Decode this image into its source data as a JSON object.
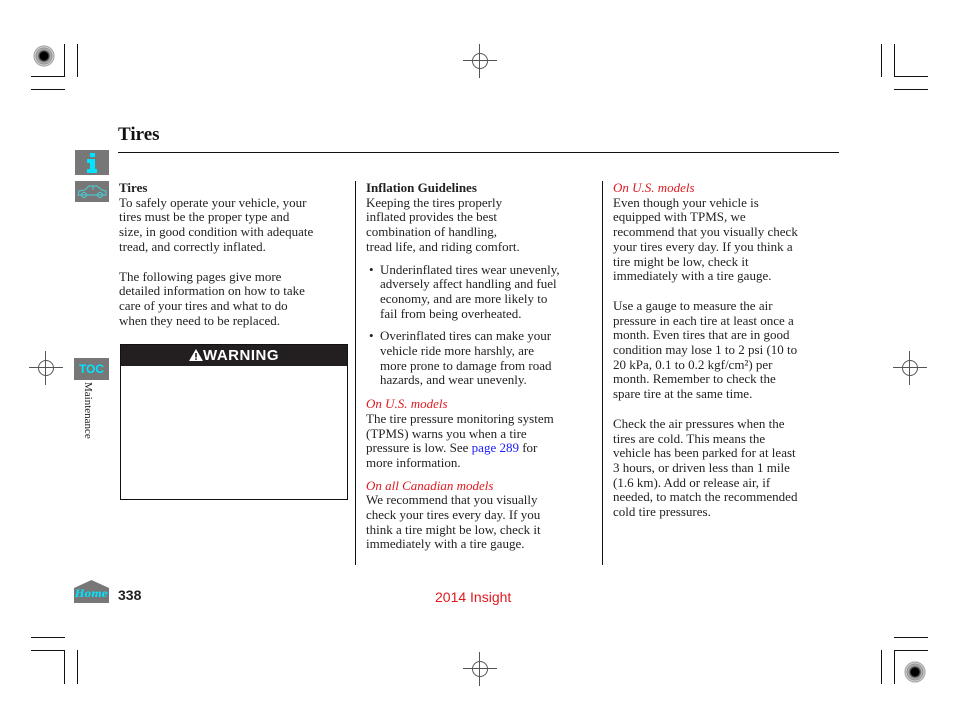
{
  "header": {
    "title": "Tires"
  },
  "side_nav": {
    "info_icon": "info-icon",
    "car_icon": "car-icon",
    "toc_label": "TOC",
    "section_label": "Maintenance",
    "home_label": "Home"
  },
  "column1": {
    "heading": "Tires",
    "paragraphs": [
      "To safely operate your vehicle, your tires must be the proper type and size, in good condition with adequate tread, and correctly inflated.",
      "The following pages give more detailed information on how to take care of your tires and what to do when they need to be replaced."
    ],
    "lines_p1": [
      "To safely operate your vehicle, your",
      "tires must be the proper type and",
      "size, in good condition with adequate",
      "tread, and correctly inflated."
    ],
    "lines_p2": [
      "The following pages give more",
      "detailed information on how to take",
      "care of your tires and what to do",
      "when they need to be replaced."
    ],
    "warning": {
      "label": "WARNING",
      "icon": "warning-triangle-icon"
    }
  },
  "column2": {
    "heading": "Inflation Guidelines",
    "intro_lines": [
      "Keeping the tires properly",
      "inflated provides the best",
      "combination of handling,",
      "tread life, and riding comfort."
    ],
    "bullets": [
      {
        "lines": [
          "Underinflated tires wear unevenly,",
          "adversely affect handling and fuel",
          "economy, and are more likely to",
          "fail from being overheated."
        ]
      },
      {
        "lines": [
          "Overinflated tires can make your",
          "vehicle ride more harshly, are",
          "more prone to damage from road",
          "hazards, and wear unevenly."
        ]
      }
    ],
    "us_models": {
      "label": "On U.S. models",
      "line1": "The tire pressure monitoring system",
      "line2": "(TPMS) warns you when a tire",
      "line3_before": "pressure is low. See ",
      "link": "page 289",
      "line3_after": " for",
      "line4": "more information."
    },
    "canadian_models": {
      "label": "On all Canadian models",
      "lines": [
        "We recommend that you visually",
        "check your tires every day. If you",
        "think a tire might be low, check it",
        "immediately with a tire gauge."
      ]
    }
  },
  "column3": {
    "us_models_label": "On U.S. models",
    "p1_lines": [
      "Even though your vehicle is",
      "equipped with TPMS, we",
      "recommend that you visually check",
      "your tires every day. If you think a",
      "tire might be low, check it",
      "immediately with a tire gauge."
    ],
    "p2_lines": [
      "Use a gauge to measure the air",
      "pressure in each tire at least once a",
      "month. Even tires that are in good",
      "condition may lose 1 to 2 psi (10 to",
      "20 kPa, 0.1 to 0.2 kgf/cm²) per",
      "month. Remember to check the",
      "spare tire at the same time."
    ],
    "p3_lines": [
      "Check the air pressures when the",
      "tires are cold. This means the",
      "vehicle has been parked for at least",
      "3 hours, or driven less than 1 mile",
      "(1.6 km). Add or release air, if",
      "needed, to match the recommended",
      "cold tire pressures."
    ]
  },
  "footer": {
    "page_number": "338",
    "document_name": "2014 Insight"
  },
  "colors": {
    "accent_red": "#e0191f",
    "link_blue": "#1a1aff",
    "nav_gray": "#777777",
    "nav_cyan": "#00e5ff"
  }
}
